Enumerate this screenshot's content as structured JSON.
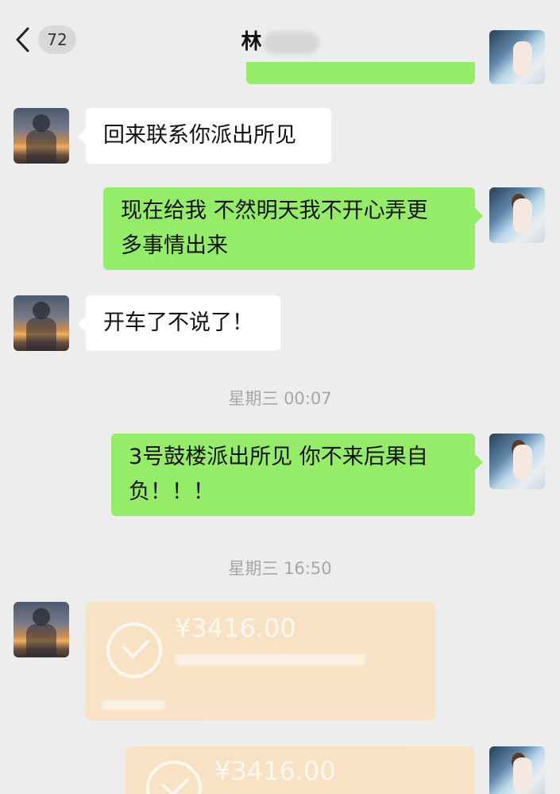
{
  "header": {
    "unread_count": "72",
    "contact_name": "林"
  },
  "messages": [
    {
      "side": "left",
      "text": "回来联系你派出所见"
    },
    {
      "side": "right",
      "line1": "现在给我 不然明天我不开心弄更",
      "line2": "多事情出来"
    },
    {
      "side": "left",
      "text": "开车了不说了！"
    },
    {
      "side": "right",
      "line1": "3号鼓楼派出所见 你不来后果自",
      "line2": "负！！！"
    }
  ],
  "timestamps": [
    "星期三 00:07",
    "星期三 16:50"
  ],
  "transfers": [
    {
      "side": "left",
      "amount": "¥3416.00"
    },
    {
      "side": "right",
      "amount": "¥3416.00"
    }
  ],
  "colors": {
    "background": "#ededed",
    "sent_bubble": "#95ec69",
    "received_bubble": "#ffffff",
    "transfer_card": "#fbe1c0",
    "timestamp_text": "#a6a6a6"
  }
}
